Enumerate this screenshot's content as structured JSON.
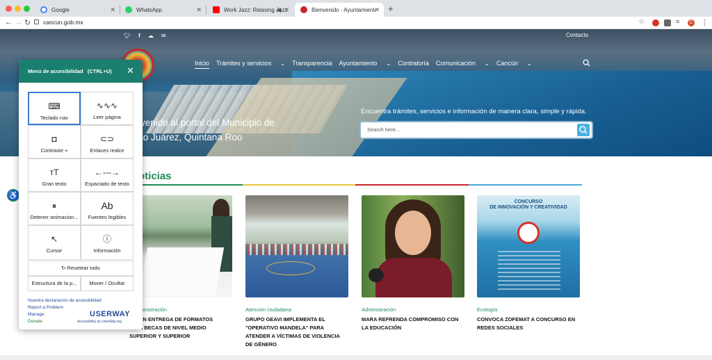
{
  "browser": {
    "tabs": [
      {
        "label": "Google",
        "color": "#4285f4"
      },
      {
        "label": "WhatsApp",
        "color": "#25d366"
      },
      {
        "label": "Work Jazz: Relaxing Jazz",
        "color": "#ff0000"
      },
      {
        "label": "Bienvenido - Ayuntamiento de",
        "color": "#c8272d"
      }
    ],
    "url": "cancun.gob.mx",
    "profile_letter": "C"
  },
  "header": {
    "contact": "Contacto",
    "menu": [
      "Inicio",
      "Trámites y servicios",
      "Transparencia",
      "Ayuntamiento",
      "Contraloría",
      "Comunicación",
      "Cancún"
    ]
  },
  "hero": {
    "title": "venido al portal del Municipio de",
    "title2": "to Juárez, Quintana Roo",
    "subtitle": "Encuentra trámites, servicios e información de manera clara, simple y rápida.",
    "search_placeholder": "Search here..."
  },
  "news": {
    "heading": "oticias",
    "cards": [
      {
        "category": "ministración",
        "title_lines": [
          "AN ENTREGA DE FORMATOS",
          "A BECAS DE NIVEL MEDIO",
          "SUPERIOR Y SUPERIOR"
        ]
      },
      {
        "category": "Atención ciudadana",
        "title_lines": [
          "GRUPO GEAVI IMPLEMENTA EL",
          "\"OPERATIVO MANDELA\" PARA",
          "ATENDER A VÍCTIMAS DE VIOLENCIA",
          "DE GÉNERO"
        ]
      },
      {
        "category": "Administración",
        "title_lines": [
          "MARA REFRENDA COMPROMISO CON",
          "LA EDUCACIÓN"
        ]
      },
      {
        "category": "Ecología",
        "title_lines": [
          "CONVOCA ZOFEMAT A CONCURSO EN",
          "REDES SOCIALES"
        ]
      }
    ],
    "poster": {
      "line1": "CONCURSO",
      "line2": "DE INNOVACIÓN Y CREATIVIDAD"
    }
  },
  "accessibility": {
    "title": "Menú de accesibilidad",
    "shortcut": "(CTRL+U)",
    "options": [
      "Teclado nav",
      "Leer página",
      "Contraste +",
      "Enlaces realce",
      "Gran texto",
      "Espaciado de texto",
      "Detener animacion...",
      "Fuentes legibles",
      "Cursor",
      "Información"
    ],
    "reset": "Resetear todo",
    "structure": "Estructura de la p...",
    "move": "Mover / Ocultar",
    "links": [
      "Nuestra declaracion de accesibilidad",
      "Report a Problem",
      "Manage",
      "Donate"
    ],
    "brand": "USERWAY",
    "brand_sub": "Accessibility by UserWay.org"
  }
}
